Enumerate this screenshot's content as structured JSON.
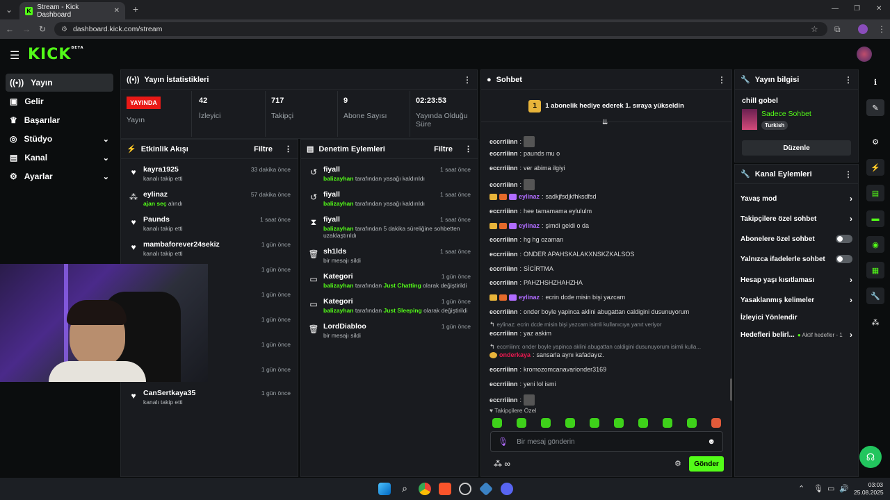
{
  "browser": {
    "tab_title": "Stream - Kick Dashboard",
    "url": "dashboard.kick.com/stream"
  },
  "brand": {
    "logo": "KICK",
    "beta": "BETA",
    "accent": "#53fc18"
  },
  "sidebar": {
    "items": [
      {
        "label": "Yayın",
        "icon": "broadcast-icon"
      },
      {
        "label": "Gelir",
        "icon": "wallet-icon"
      },
      {
        "label": "Başarılar",
        "icon": "trophy-icon"
      },
      {
        "label": "Stüdyo",
        "icon": "studio-icon"
      },
      {
        "label": "Kanal",
        "icon": "user-icon"
      },
      {
        "label": "Ayarlar",
        "icon": "gear-icon"
      }
    ]
  },
  "stats": {
    "title": "Yayın İstatistikleri",
    "live_badge": "YAYINDA",
    "live_label": "Yayın",
    "viewers": "42",
    "viewers_label": "İzleyici",
    "followers": "717",
    "followers_label": "Takipçi",
    "subs": "9",
    "subs_label": "Abone Sayısı",
    "uptime": "02:23:53",
    "uptime_label": "Yayında Olduğu Süre"
  },
  "activity": {
    "title": "Etkinlik Akışı",
    "filter": "Filtre",
    "items": [
      {
        "name": "kayra1925",
        "sub": "kanalı takip etti",
        "time": "33 dakika önce"
      },
      {
        "name": "eylinaz",
        "sub_green": "ajan seç",
        "sub": " alındı",
        "time": "57 dakika önce"
      },
      {
        "name": "Paunds",
        "sub": "kanalı takip etti",
        "time": "1 saat önce"
      },
      {
        "name": "mambaforever24sekiz",
        "sub": "kanalı takip etti",
        "time": "1 gün önce"
      },
      {
        "name": "",
        "sub": "",
        "time": "1 gün önce"
      },
      {
        "name": "",
        "sub": "",
        "time": "1 gün önce"
      },
      {
        "name": "",
        "sub": "",
        "time": "1 gün önce"
      },
      {
        "name": "",
        "sub": "",
        "time": "1 gün önce"
      },
      {
        "name": "",
        "sub": "",
        "time": "1 gün önce"
      },
      {
        "name": "CanSertkaya35",
        "sub": "kanalı takip etti",
        "time": "1 gün önce"
      }
    ]
  },
  "moderation": {
    "title": "Denetim Eylemleri",
    "filter": "Filtre",
    "items": [
      {
        "name": "fiyall",
        "actor": "balizayhan",
        "text": " tarafından yasağı kaldırıldı",
        "time": "1 saat önce"
      },
      {
        "name": "fiyall",
        "actor": "balizayhan",
        "text": " tarafından yasağı kaldırıldı",
        "time": "1 saat önce"
      },
      {
        "name": "fiyall",
        "actor": "balizayhan",
        "text": " tarafından 5 dakika süreliğine sohbetten",
        "text2": "uzaklaştırıldı",
        "time": "1 saat önce"
      },
      {
        "name": "sh1lds",
        "text_plain": "bir mesajı sildi",
        "time": "1 saat önce"
      },
      {
        "name": "Kategori",
        "actor": "balizayhan",
        "text": " tarafından ",
        "cat": "Just Chatting",
        "tail": " olarak değiştirildi",
        "time": "1 gün önce"
      },
      {
        "name": "Kategori",
        "actor": "balizayhan",
        "text": " tarafından ",
        "cat": "Just Sleeping",
        "tail": " olarak değiştirildi",
        "time": "1 gün önce"
      },
      {
        "name": "LordDiabloo",
        "text_plain": "bir mesajı sildi",
        "time": "1 gün önce"
      }
    ]
  },
  "chat": {
    "title": "Sohbet",
    "pinned_rank": "1",
    "pinned": "1 abonelik hediye ederek 1. sıraya yükseldin",
    "messages": [
      {
        "user": "eccrriiinn",
        "text": ""
      },
      {
        "user": "eccrriiinn",
        "text": "paunds mu o"
      },
      {
        "user": "eccrriiinn",
        "text": "ver abima ilgiyi"
      },
      {
        "user": "eccrriiinn",
        "text": ""
      },
      {
        "user": "eylinaz",
        "text": "sadkjfsdjkfhksdfsd",
        "purple": true
      },
      {
        "user": "eccrriiinn",
        "text": "hee tamamama eylululm"
      },
      {
        "user": "eylinaz",
        "text": "şimdi geldi o da",
        "purple": true
      },
      {
        "user": "eccrriiinn",
        "text": "hg hg ozaman"
      },
      {
        "user": "eccrriiinn",
        "text": "ONDER APAHSKALAKXNSKZKALSOS"
      },
      {
        "user": "eccrriiinn",
        "text": "SİCİRTMA"
      },
      {
        "user": "eccrriiinn",
        "text": "PAHZHSHZHAHZHA"
      },
      {
        "user": "eylinaz",
        "text": "ecrin dcde misin bişi yazcam",
        "purple": true
      },
      {
        "user": "eccrriiinn",
        "text": "onder boyle yapinca aklini abugattan caldigini dusunuyorum"
      },
      {
        "reply": "eylinaz: ecrin dcde misin bişi yazcam isimli kullanıcıya yanıt veriyor"
      },
      {
        "user": "eccrriiinn",
        "text": "yaz askim"
      },
      {
        "reply": "eccrriiinn: onder boyle yapinca aklini abugattan caldigini dusunuyorum isimli kulla..."
      },
      {
        "user": "onderkaya",
        "text": "sansarla aynı kafadayız.",
        "red": true
      },
      {
        "user": "eccrriiinn",
        "text": "kromozomcanavarionder3169"
      },
      {
        "user": "eccrriiinn",
        "text": "yeni lol ismi"
      },
      {
        "user": "eccrriiinn",
        "text": ""
      }
    ],
    "followers_only": "Takipçilere Özel",
    "input_placeholder": "Bir mesaj gönderin",
    "send": "Gönder"
  },
  "stream_info": {
    "title": "Yayın bilgisi",
    "stream_title": "chill gobel",
    "category": "Sadece Sohbet",
    "language": "Turkish",
    "edit": "Düzenle"
  },
  "channel_actions": {
    "title": "Kanal Eylemleri",
    "items": [
      {
        "label": "Yavaş mod",
        "type": "chev"
      },
      {
        "label": "Takipçilere özel sohbet",
        "type": "chev"
      },
      {
        "label": "Abonelere özel sohbet",
        "type": "toggle"
      },
      {
        "label": "Yalnızca ifadelerle sohbet",
        "type": "toggle"
      },
      {
        "label": "Hesap yaşı kısıtlaması",
        "type": "chev"
      },
      {
        "label": "Yasaklanmış kelimeler",
        "type": "chev"
      },
      {
        "label": "İzleyici Yönlendir",
        "type": "none"
      },
      {
        "label": "Hedefleri belirl...",
        "type": "chev",
        "extra": "Aktif hedefler - 1"
      }
    ]
  },
  "taskbar": {
    "time": "03:03",
    "date": "25.08.2025"
  }
}
